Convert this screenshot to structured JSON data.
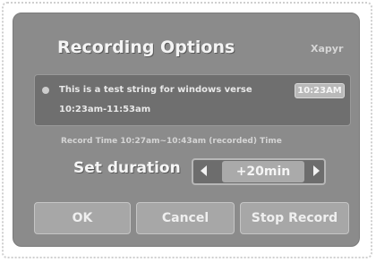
{
  "dialog": {
    "title": "Recording Options",
    "corner_text": "Xapyr"
  },
  "info": {
    "line1": "This is a test string for windows verse",
    "line2": "10:23am-11:53am",
    "time_box": "10:23AM"
  },
  "record_time": "Record Time 10:27am~10:43am (recorded) Time",
  "duration": {
    "label": "Set duration",
    "value": "+20min"
  },
  "buttons": {
    "ok": "OK",
    "cancel": "Cancel",
    "stop": "Stop Record"
  }
}
